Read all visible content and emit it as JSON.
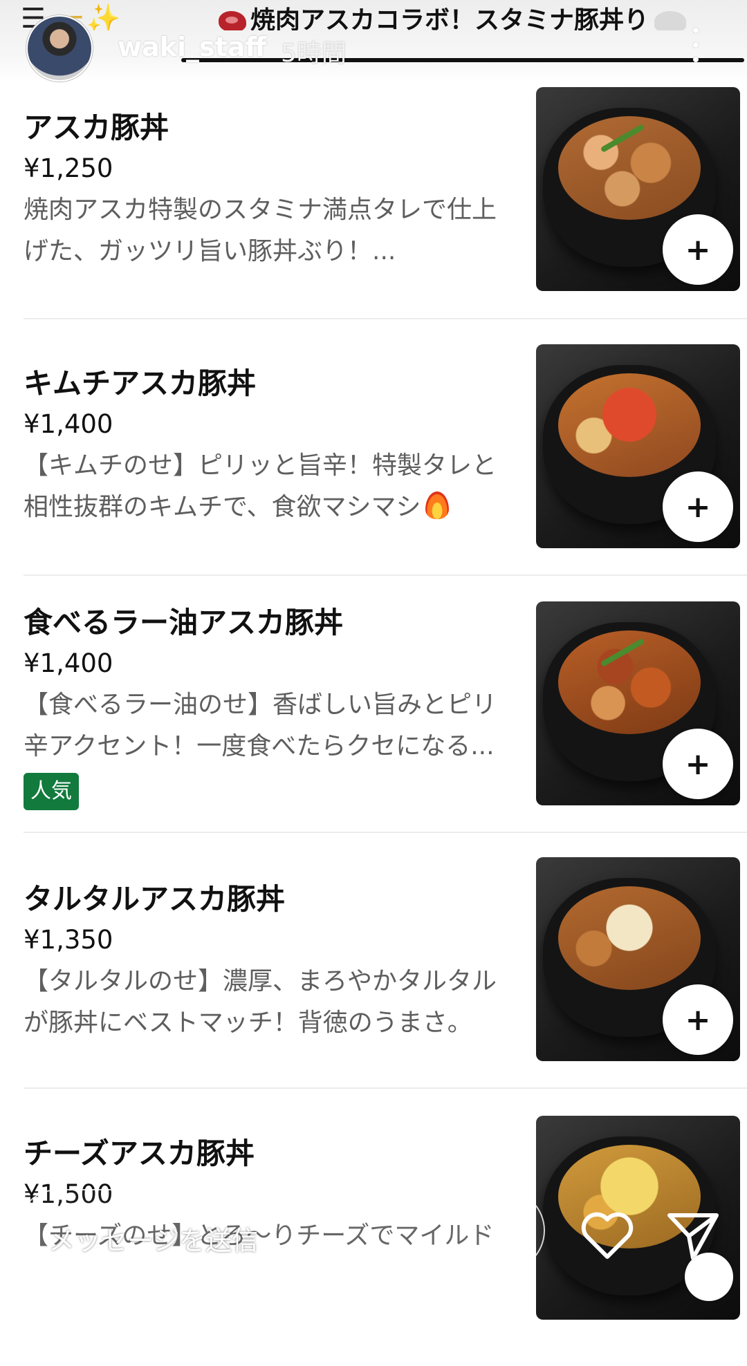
{
  "story": {
    "title_prefix": "ー✨",
    "title_main": "焼肉アスカコラボ！スタミナ豚丼り",
    "username": "waki_staff",
    "time": "5時間",
    "reply_placeholder": "メッセージを送信"
  },
  "menu": {
    "items": [
      {
        "name": "アスカ豚丼",
        "price": "¥1,250",
        "desc_line1": "焼肉アスカ特製のスタミナ満点タレで仕上",
        "desc_line2": "げた、ガッツリ旨い豚丼ぶり！..."
      },
      {
        "name": "キムチアスカ豚丼",
        "price": "¥1,400",
        "desc_line1": "【キムチのせ】ピリッと旨辛！特製タレと",
        "desc_line2": "相性抜群のキムチで、食欲マシマシ"
      },
      {
        "name": "食べるラー油アスカ豚丼",
        "price": "¥1,400",
        "desc_line1": "【食べるラー油のせ】香ばしい旨みとピリ",
        "desc_line2": "辛アクセント！一度食べたらクセになる...",
        "badge": "人気"
      },
      {
        "name": "タルタルアスカ豚丼",
        "price": "¥1,350",
        "desc_line1": "【タルタルのせ】濃厚、まろやかタルタル",
        "desc_line2": "が豚丼にベストマッチ！背徳のうまさ。"
      },
      {
        "name": "チーズアスカ豚丼",
        "price": "¥1,500",
        "desc_line1": "【チーズのせ】とろ〜りチーズでマイルド"
      }
    ],
    "add_label": "+"
  },
  "colors": {
    "badge_bg": "#117a3c",
    "description": "#5e5e5e",
    "divider": "#ececec"
  }
}
